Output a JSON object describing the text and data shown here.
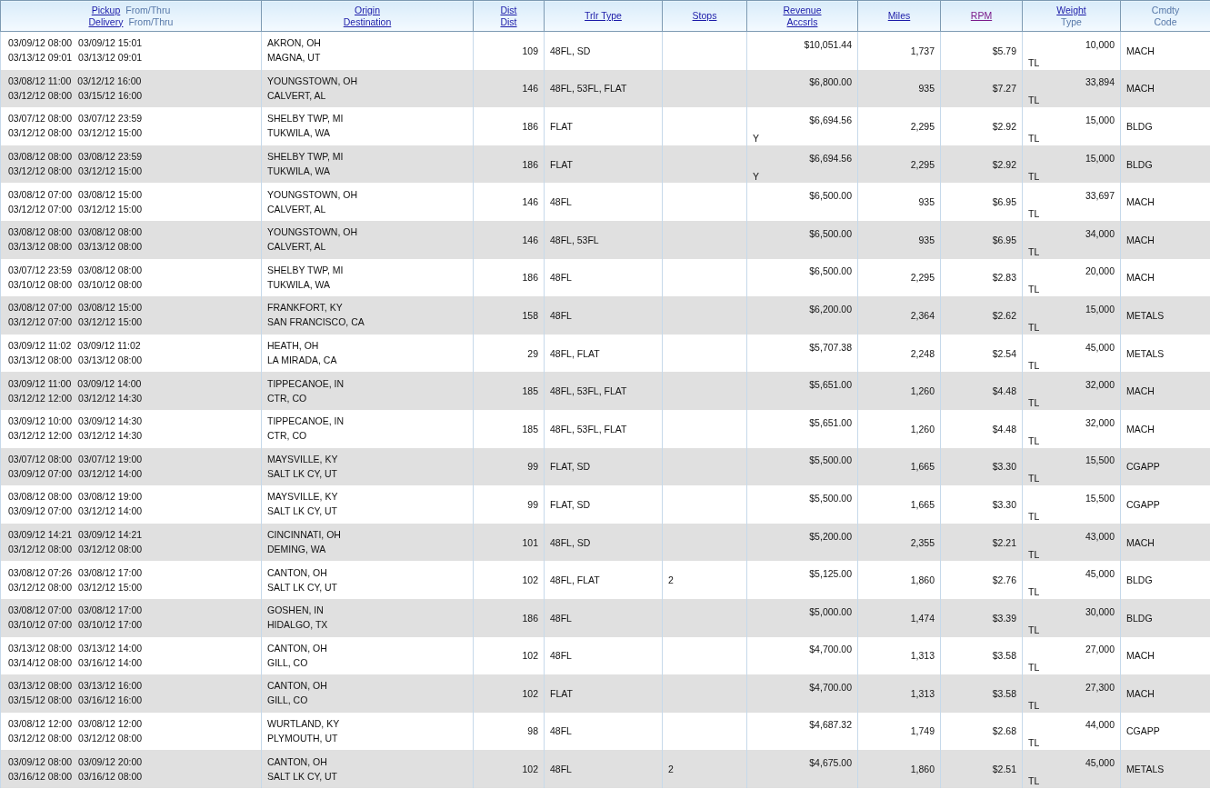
{
  "columns": [
    {
      "lines": [
        [
          {
            "text": "Pickup",
            "kind": "link"
          },
          {
            "text": "From/Thru",
            "kind": "plain"
          }
        ],
        [
          {
            "text": "Delivery",
            "kind": "link"
          },
          {
            "text": "From/Thru",
            "kind": "plain"
          }
        ]
      ]
    },
    {
      "lines": [
        [
          {
            "text": "Origin",
            "kind": "link"
          }
        ],
        [
          {
            "text": "Destination",
            "kind": "link"
          }
        ]
      ]
    },
    {
      "lines": [
        [
          {
            "text": "Dist",
            "kind": "link"
          }
        ],
        [
          {
            "text": "Dist",
            "kind": "link"
          }
        ]
      ]
    },
    {
      "lines": [
        [
          {
            "text": "Trlr Type",
            "kind": "link"
          }
        ]
      ]
    },
    {
      "lines": [
        [
          {
            "text": "Stops",
            "kind": "link"
          }
        ]
      ]
    },
    {
      "lines": [
        [
          {
            "text": "Revenue",
            "kind": "link"
          }
        ],
        [
          {
            "text": "Accsrls",
            "kind": "link"
          }
        ]
      ]
    },
    {
      "lines": [
        [
          {
            "text": "Miles",
            "kind": "link"
          }
        ]
      ]
    },
    {
      "lines": [
        [
          {
            "text": "RPM",
            "kind": "visited"
          }
        ]
      ]
    },
    {
      "lines": [
        [
          {
            "text": "Weight",
            "kind": "link"
          }
        ],
        [
          {
            "text": "Type",
            "kind": "plain"
          }
        ]
      ]
    },
    {
      "lines": [
        [
          {
            "text": "Cmdty",
            "kind": "plain"
          }
        ],
        [
          {
            "text": "Code",
            "kind": "plain"
          }
        ]
      ]
    }
  ],
  "rows": [
    {
      "pickup_from": "03/09/12 08:00",
      "pickup_thru": "03/09/12 15:01",
      "delivery_from": "03/13/12 09:01",
      "delivery_thru": "03/13/12 09:01",
      "origin": "AKRON, OH",
      "destination": "MAGNA, UT",
      "dist": "109",
      "trailer_type": "48FL, SD",
      "stops": "",
      "revenue": "$10,051.44",
      "accessorials": "",
      "miles": "1,737",
      "rpm": "$5.79",
      "weight": "10,000",
      "type": "TL",
      "commodity": "MACH"
    },
    {
      "pickup_from": "03/08/12 11:00",
      "pickup_thru": "03/12/12 16:00",
      "delivery_from": "03/12/12 08:00",
      "delivery_thru": "03/15/12 16:00",
      "origin": "YOUNGSTOWN, OH",
      "destination": "CALVERT, AL",
      "dist": "146",
      "trailer_type": "48FL, 53FL, FLAT",
      "stops": "",
      "revenue": "$6,800.00",
      "accessorials": "",
      "miles": "935",
      "rpm": "$7.27",
      "weight": "33,894",
      "type": "TL",
      "commodity": "MACH"
    },
    {
      "pickup_from": "03/07/12 08:00",
      "pickup_thru": "03/07/12 23:59",
      "delivery_from": "03/12/12 08:00",
      "delivery_thru": "03/12/12 15:00",
      "origin": "SHELBY TWP, MI",
      "destination": "TUKWILA, WA",
      "dist": "186",
      "trailer_type": "FLAT",
      "stops": "",
      "revenue": "$6,694.56",
      "accessorials": "Y",
      "miles": "2,295",
      "rpm": "$2.92",
      "weight": "15,000",
      "type": "TL",
      "commodity": "BLDG"
    },
    {
      "pickup_from": "03/08/12 08:00",
      "pickup_thru": "03/08/12 23:59",
      "delivery_from": "03/12/12 08:00",
      "delivery_thru": "03/12/12 15:00",
      "origin": "SHELBY TWP, MI",
      "destination": "TUKWILA, WA",
      "dist": "186",
      "trailer_type": "FLAT",
      "stops": "",
      "revenue": "$6,694.56",
      "accessorials": "Y",
      "miles": "2,295",
      "rpm": "$2.92",
      "weight": "15,000",
      "type": "TL",
      "commodity": "BLDG"
    },
    {
      "pickup_from": "03/08/12 07:00",
      "pickup_thru": "03/08/12 15:00",
      "delivery_from": "03/12/12 07:00",
      "delivery_thru": "03/12/12 15:00",
      "origin": "YOUNGSTOWN, OH",
      "destination": "CALVERT, AL",
      "dist": "146",
      "trailer_type": "48FL",
      "stops": "",
      "revenue": "$6,500.00",
      "accessorials": "",
      "miles": "935",
      "rpm": "$6.95",
      "weight": "33,697",
      "type": "TL",
      "commodity": "MACH"
    },
    {
      "pickup_from": "03/08/12 08:00",
      "pickup_thru": "03/08/12 08:00",
      "delivery_from": "03/13/12 08:00",
      "delivery_thru": "03/13/12 08:00",
      "origin": "YOUNGSTOWN, OH",
      "destination": "CALVERT, AL",
      "dist": "146",
      "trailer_type": "48FL, 53FL",
      "stops": "",
      "revenue": "$6,500.00",
      "accessorials": "",
      "miles": "935",
      "rpm": "$6.95",
      "weight": "34,000",
      "type": "TL",
      "commodity": "MACH"
    },
    {
      "pickup_from": "03/07/12 23:59",
      "pickup_thru": "03/08/12 08:00",
      "delivery_from": "03/10/12 08:00",
      "delivery_thru": "03/10/12 08:00",
      "origin": "SHELBY TWP, MI",
      "destination": "TUKWILA, WA",
      "dist": "186",
      "trailer_type": "48FL",
      "stops": "",
      "revenue": "$6,500.00",
      "accessorials": "",
      "miles": "2,295",
      "rpm": "$2.83",
      "weight": "20,000",
      "type": "TL",
      "commodity": "MACH"
    },
    {
      "pickup_from": "03/08/12 07:00",
      "pickup_thru": "03/08/12 15:00",
      "delivery_from": "03/12/12 07:00",
      "delivery_thru": "03/12/12 15:00",
      "origin": "FRANKFORT, KY",
      "destination": "SAN FRANCISCO, CA",
      "dist": "158",
      "trailer_type": "48FL",
      "stops": "",
      "revenue": "$6,200.00",
      "accessorials": "",
      "miles": "2,364",
      "rpm": "$2.62",
      "weight": "15,000",
      "type": "TL",
      "commodity": "METALS"
    },
    {
      "pickup_from": "03/09/12 11:02",
      "pickup_thru": "03/09/12 11:02",
      "delivery_from": "03/13/12 08:00",
      "delivery_thru": "03/13/12 08:00",
      "origin": "HEATH, OH",
      "destination": "LA MIRADA, CA",
      "dist": "29",
      "trailer_type": "48FL, FLAT",
      "stops": "",
      "revenue": "$5,707.38",
      "accessorials": "",
      "miles": "2,248",
      "rpm": "$2.54",
      "weight": "45,000",
      "type": "TL",
      "commodity": "METALS"
    },
    {
      "pickup_from": "03/09/12 11:00",
      "pickup_thru": "03/09/12 14:00",
      "delivery_from": "03/12/12 12:00",
      "delivery_thru": "03/12/12 14:30",
      "origin": "TIPPECANOE, IN",
      "destination": "CTR, CO",
      "dist": "185",
      "trailer_type": "48FL, 53FL, FLAT",
      "stops": "",
      "revenue": "$5,651.00",
      "accessorials": "",
      "miles": "1,260",
      "rpm": "$4.48",
      "weight": "32,000",
      "type": "TL",
      "commodity": "MACH"
    },
    {
      "pickup_from": "03/09/12 10:00",
      "pickup_thru": "03/09/12 14:30",
      "delivery_from": "03/12/12 12:00",
      "delivery_thru": "03/12/12 14:30",
      "origin": "TIPPECANOE, IN",
      "destination": "CTR, CO",
      "dist": "185",
      "trailer_type": "48FL, 53FL, FLAT",
      "stops": "",
      "revenue": "$5,651.00",
      "accessorials": "",
      "miles": "1,260",
      "rpm": "$4.48",
      "weight": "32,000",
      "type": "TL",
      "commodity": "MACH"
    },
    {
      "pickup_from": "03/07/12 08:00",
      "pickup_thru": "03/07/12 19:00",
      "delivery_from": "03/09/12 07:00",
      "delivery_thru": "03/12/12 14:00",
      "origin": "MAYSVILLE, KY",
      "destination": "SALT LK CY, UT",
      "dist": "99",
      "trailer_type": "FLAT, SD",
      "stops": "",
      "revenue": "$5,500.00",
      "accessorials": "",
      "miles": "1,665",
      "rpm": "$3.30",
      "weight": "15,500",
      "type": "TL",
      "commodity": "CGAPP"
    },
    {
      "pickup_from": "03/08/12 08:00",
      "pickup_thru": "03/08/12 19:00",
      "delivery_from": "03/09/12 07:00",
      "delivery_thru": "03/12/12 14:00",
      "origin": "MAYSVILLE, KY",
      "destination": "SALT LK CY, UT",
      "dist": "99",
      "trailer_type": "FLAT, SD",
      "stops": "",
      "revenue": "$5,500.00",
      "accessorials": "",
      "miles": "1,665",
      "rpm": "$3.30",
      "weight": "15,500",
      "type": "TL",
      "commodity": "CGAPP"
    },
    {
      "pickup_from": "03/09/12 14:21",
      "pickup_thru": "03/09/12 14:21",
      "delivery_from": "03/12/12 08:00",
      "delivery_thru": "03/12/12 08:00",
      "origin": "CINCINNATI, OH",
      "destination": "DEMING, WA",
      "dist": "101",
      "trailer_type": "48FL, SD",
      "stops": "",
      "revenue": "$5,200.00",
      "accessorials": "",
      "miles": "2,355",
      "rpm": "$2.21",
      "weight": "43,000",
      "type": "TL",
      "commodity": "MACH"
    },
    {
      "pickup_from": "03/08/12 07:26",
      "pickup_thru": "03/08/12 17:00",
      "delivery_from": "03/12/12 08:00",
      "delivery_thru": "03/12/12 15:00",
      "origin": "CANTON, OH",
      "destination": "SALT LK CY, UT",
      "dist": "102",
      "trailer_type": "48FL, FLAT",
      "stops": "2",
      "revenue": "$5,125.00",
      "accessorials": "",
      "miles": "1,860",
      "rpm": "$2.76",
      "weight": "45,000",
      "type": "TL",
      "commodity": "BLDG"
    },
    {
      "pickup_from": "03/08/12 07:00",
      "pickup_thru": "03/08/12 17:00",
      "delivery_from": "03/10/12 07:00",
      "delivery_thru": "03/10/12 17:00",
      "origin": "GOSHEN, IN",
      "destination": "HIDALGO, TX",
      "dist": "186",
      "trailer_type": "48FL",
      "stops": "",
      "revenue": "$5,000.00",
      "accessorials": "",
      "miles": "1,474",
      "rpm": "$3.39",
      "weight": "30,000",
      "type": "TL",
      "commodity": "BLDG"
    },
    {
      "pickup_from": "03/13/12 08:00",
      "pickup_thru": "03/13/12 14:00",
      "delivery_from": "03/14/12 08:00",
      "delivery_thru": "03/16/12 14:00",
      "origin": "CANTON, OH",
      "destination": "GILL, CO",
      "dist": "102",
      "trailer_type": "48FL",
      "stops": "",
      "revenue": "$4,700.00",
      "accessorials": "",
      "miles": "1,313",
      "rpm": "$3.58",
      "weight": "27,000",
      "type": "TL",
      "commodity": "MACH"
    },
    {
      "pickup_from": "03/13/12 08:00",
      "pickup_thru": "03/13/12 16:00",
      "delivery_from": "03/15/12 08:00",
      "delivery_thru": "03/16/12 16:00",
      "origin": "CANTON, OH",
      "destination": "GILL, CO",
      "dist": "102",
      "trailer_type": "FLAT",
      "stops": "",
      "revenue": "$4,700.00",
      "accessorials": "",
      "miles": "1,313",
      "rpm": "$3.58",
      "weight": "27,300",
      "type": "TL",
      "commodity": "MACH"
    },
    {
      "pickup_from": "03/08/12 12:00",
      "pickup_thru": "03/08/12 12:00",
      "delivery_from": "03/12/12 08:00",
      "delivery_thru": "03/12/12 08:00",
      "origin": "WURTLAND, KY",
      "destination": "PLYMOUTH, UT",
      "dist": "98",
      "trailer_type": "48FL",
      "stops": "",
      "revenue": "$4,687.32",
      "accessorials": "",
      "miles": "1,749",
      "rpm": "$2.68",
      "weight": "44,000",
      "type": "TL",
      "commodity": "CGAPP"
    },
    {
      "pickup_from": "03/09/12 08:00",
      "pickup_thru": "03/09/12 20:00",
      "delivery_from": "03/16/12 08:00",
      "delivery_thru": "03/16/12 08:00",
      "origin": "CANTON, OH",
      "destination": "SALT LK CY, UT",
      "dist": "102",
      "trailer_type": "48FL",
      "stops": "2",
      "revenue": "$4,675.00",
      "accessorials": "",
      "miles": "1,860",
      "rpm": "$2.51",
      "weight": "45,000",
      "type": "TL",
      "commodity": "METALS"
    }
  ]
}
